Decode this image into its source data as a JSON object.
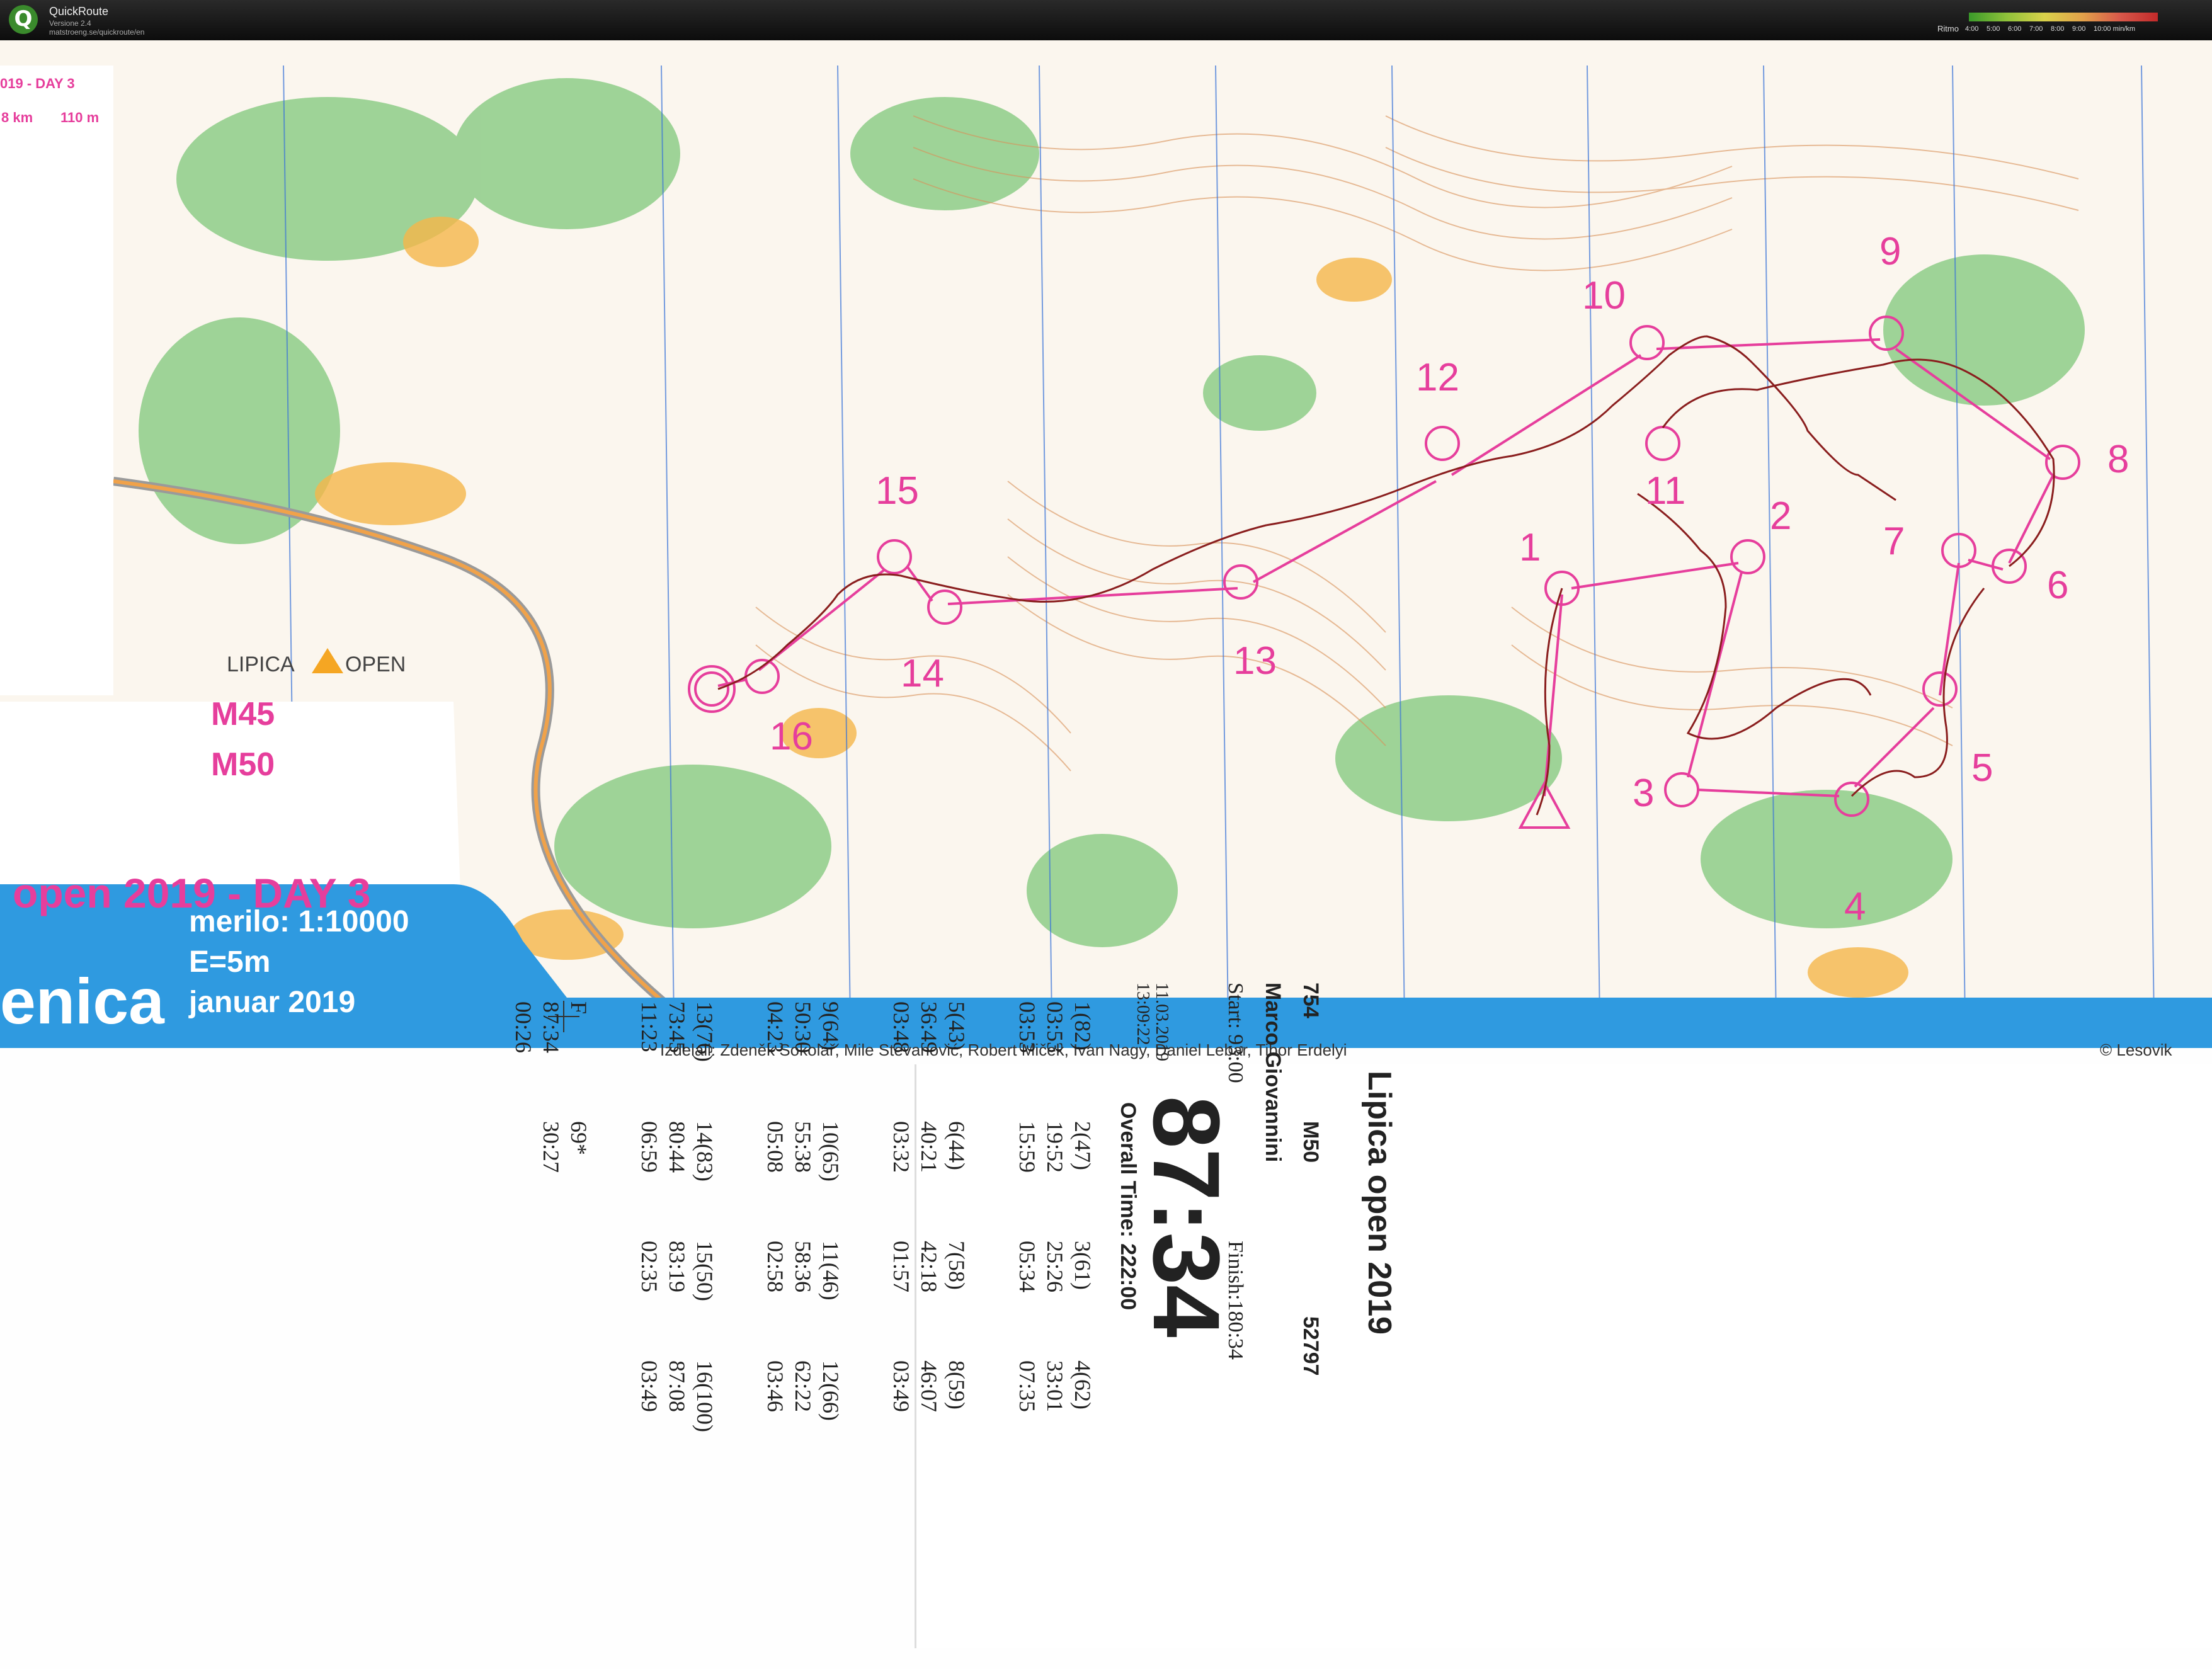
{
  "app": {
    "title": "QuickRoute",
    "version": "Versione 2.4",
    "url": "matstroeng.se/quickroute/en",
    "pace_label": "Ritmo",
    "pace_ticks": [
      "4:00",
      "5:00",
      "6:00",
      "7:00",
      "8:00",
      "9:00",
      "10:00 min/km"
    ]
  },
  "map": {
    "legend_header": "019 - DAY 3",
    "legend_km": "8 km",
    "legend_m": "110 m",
    "logo_left": "LIPICA",
    "logo_right": "OPEN",
    "classes": [
      "M45",
      "M50"
    ],
    "day_title": "open 2019  - DAY 3",
    "venue": "enica",
    "scale": "merilo: 1:10000",
    "equidistance": "E=5m",
    "date": "januar 2019",
    "credits": "Izdelali: Zdeněk Sokolář, Mile Stevanović, Robert Miček, Ivan Nagy, Daniel Lebar, Tibor Erdelyi",
    "copyright": "© Lesovik",
    "controls": [
      "1",
      "2",
      "3",
      "4",
      "5",
      "6",
      "7",
      "8",
      "9",
      "10",
      "11",
      "12",
      "13",
      "14",
      "15",
      "16"
    ]
  },
  "card": {
    "event": "Lipica open 2019",
    "id": "754",
    "class": "M50",
    "chip": "52797",
    "name": "Marco Giovannini",
    "start": "Start: 93:00",
    "finish": "Finish:180:34",
    "result": "87:34",
    "overall": "Overall Time: 222:00",
    "date": "11.03.2019",
    "time": "13:09:22",
    "splits": [
      [
        "1(82)",
        "03:53",
        "03:53"
      ],
      [
        "2(47)",
        "19:52",
        "15:59"
      ],
      [
        "3(61)",
        "25:26",
        "05:34"
      ],
      [
        "4(62)",
        "33:01",
        "07:35"
      ],
      [
        "5(43)",
        "36:49",
        "03:48"
      ],
      [
        "6(44)",
        "40:21",
        "03:32"
      ],
      [
        "7(58)",
        "42:18",
        "01:57"
      ],
      [
        "8(59)",
        "46:07",
        "03:49"
      ],
      [
        "9(64)",
        "50:30",
        "04:23"
      ],
      [
        "10(65)",
        "55:38",
        "05:08"
      ],
      [
        "11(46)",
        "58:36",
        "02:58"
      ],
      [
        "12(66)",
        "62:22",
        "03:46"
      ],
      [
        "13(76)",
        "73:45",
        "11:23"
      ],
      [
        "14(83)",
        "80:44",
        "06:59"
      ],
      [
        "15(50)",
        "83:19",
        "02:35"
      ],
      [
        "16(100)",
        "87:08",
        "03:49"
      ],
      [
        "F",
        "87:34",
        "00:26"
      ],
      [
        "69*",
        "30:27",
        ""
      ]
    ]
  }
}
